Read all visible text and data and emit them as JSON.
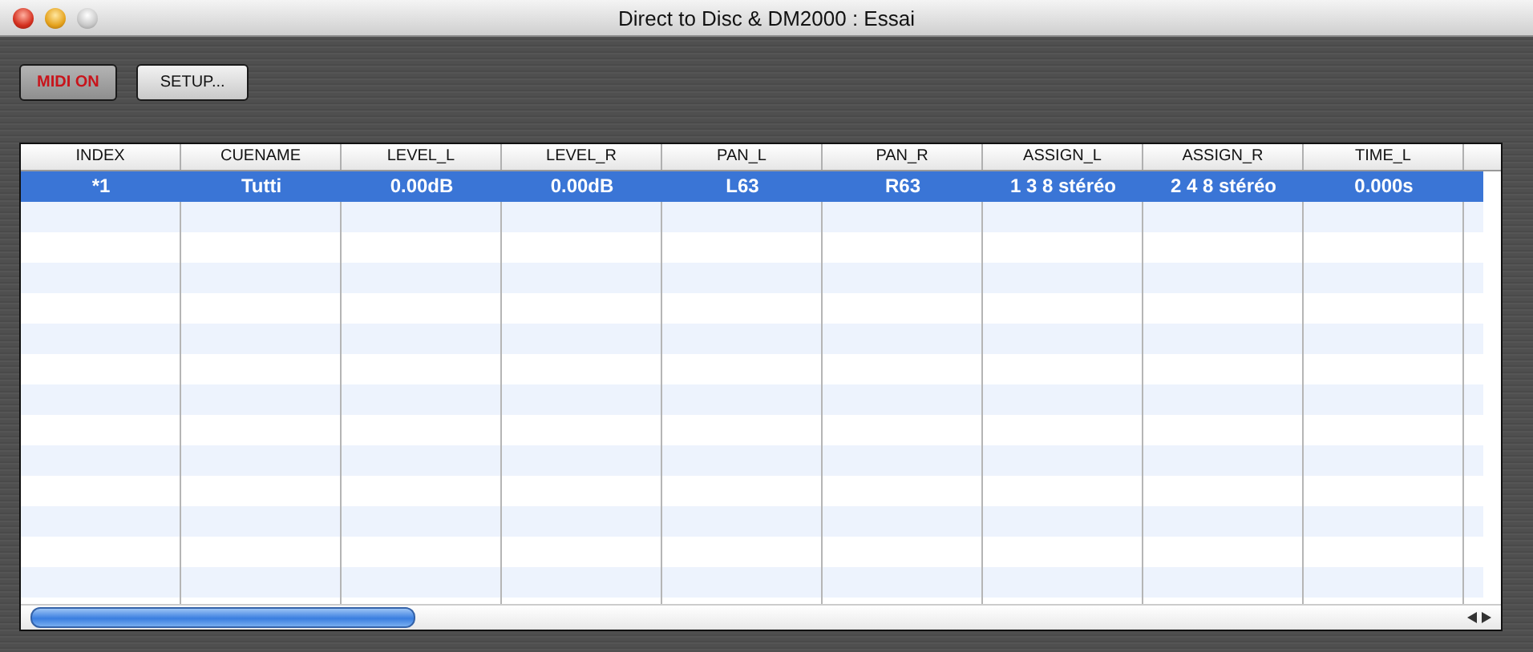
{
  "window": {
    "title": "Direct to Disc & DM2000 : Essai"
  },
  "toolbar": [
    {
      "label": "MIDI ON",
      "on": true
    },
    {
      "label": "SETUP...",
      "on": false
    }
  ],
  "table": {
    "columns": [
      "INDEX",
      "CUENAME",
      "LEVEL_L",
      "LEVEL_R",
      "PAN_L",
      "PAN_R",
      "ASSIGN_L",
      "ASSIGN_R",
      "TIME_L"
    ],
    "rows": [
      {
        "selected": true,
        "cells": [
          "*1",
          "Tutti",
          "0.00dB",
          "0.00dB",
          "L63",
          "R63",
          "1 3 8 stéréo",
          "2 4 8 stéréo",
          "0.000s"
        ]
      }
    ]
  }
}
